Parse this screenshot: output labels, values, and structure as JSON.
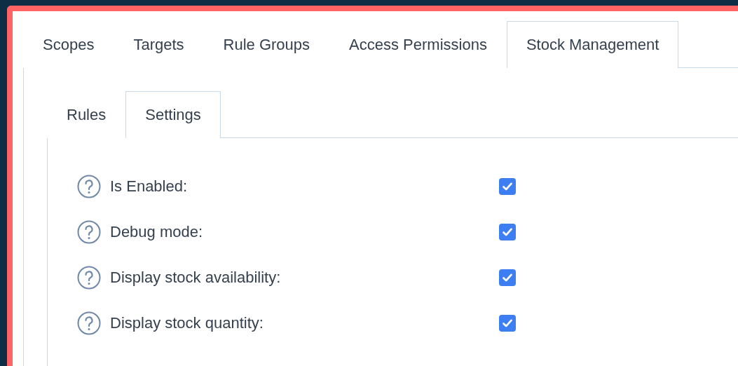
{
  "tabs": [
    {
      "label": "Scopes",
      "selected": false
    },
    {
      "label": "Targets",
      "selected": false
    },
    {
      "label": "Rule Groups",
      "selected": false
    },
    {
      "label": "Access Permissions",
      "selected": false
    },
    {
      "label": "Stock Management",
      "selected": true
    }
  ],
  "subtabs": [
    {
      "label": "Rules",
      "selected": false
    },
    {
      "label": "Settings",
      "selected": true
    }
  ],
  "settings": [
    {
      "label": "Is Enabled:",
      "checked": true
    },
    {
      "label": "Debug mode:",
      "checked": true
    },
    {
      "label": "Display stock availability:",
      "checked": true
    },
    {
      "label": "Display stock quantity:",
      "checked": true
    }
  ]
}
